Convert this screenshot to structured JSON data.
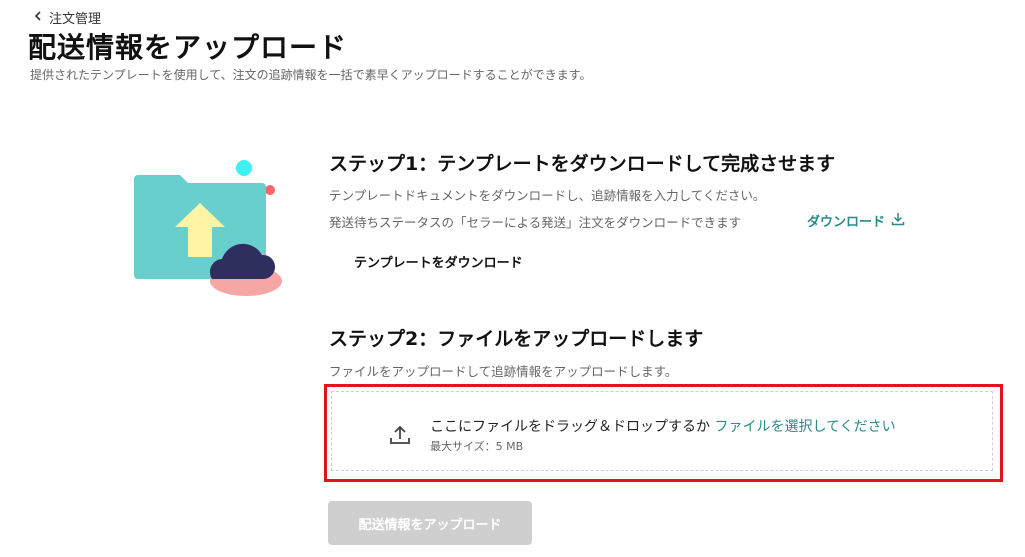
{
  "breadcrumb": {
    "label": "注文管理",
    "icon": "chevron-left-icon"
  },
  "page": {
    "title": "配送情報をアップロード",
    "subtitle": "提供されたテンプレートを使用して、注文の追跡情報を一括で素早くアップロードすることができます。"
  },
  "illustration": {
    "icon": "folder-upload-illustration",
    "colors": {
      "folder": "#69cfcc",
      "arrow": "#fff3a6",
      "cloud_dark": "#2f2f5f",
      "cloud_pink": "#f7a6a6",
      "dot_cyan": "#3ef0f0",
      "dot_red": "#f0686a"
    }
  },
  "step1": {
    "title": "ステップ1：テンプレートをダウンロードして完成させます",
    "desc1": "テンプレートドキュメントをダウンロードし、追跡情報を入力してください。",
    "desc2": "発送待ちステータスの「セラーによる発送」注文をダウンロードできます",
    "download_link": "ダウンロード",
    "download_icon": "download-icon",
    "template_link": "テンプレートをダウンロード"
  },
  "step2": {
    "title": "ステップ2：ファイルをアップロードします",
    "desc": "ファイルをアップロードして追跡情報をアップロードします。",
    "dropzone": {
      "text": "ここにファイルをドラッグ＆ドロップするか",
      "link": "ファイルを選択してください",
      "max_size": "最大サイズ：5 MB",
      "icon": "upload-icon"
    }
  },
  "upload_button": {
    "label": "配送情報をアップロード",
    "state": "disabled"
  },
  "colors": {
    "accent": "#2a8a88",
    "highlight": "#e3141d",
    "button_disabled": "#cfcfcf"
  }
}
